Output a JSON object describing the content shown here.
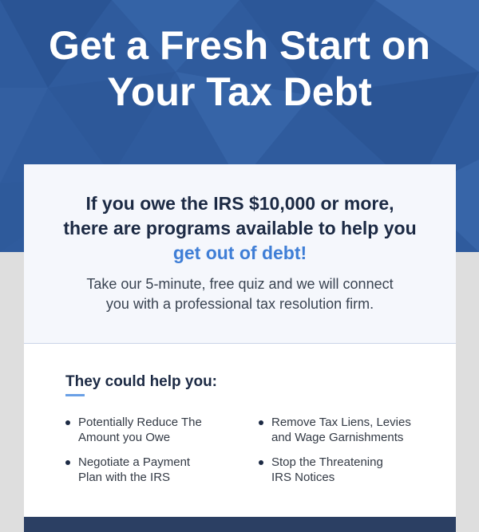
{
  "hero": {
    "title_line1": "Get a Fresh Start on",
    "title_line2": "Your Tax Debt",
    "background_color": "#2f5b9d"
  },
  "card": {
    "headline_line1": "If you owe the IRS $10,000 or more,",
    "headline_line2": "there are programs available to help you",
    "headline_accent": "get out of debt!",
    "subtext_line1": "Take our 5-minute, free quiz and we will connect",
    "subtext_line2": "you with a professional tax resolution firm.",
    "help_title": "They could help you:",
    "bullets_left": [
      {
        "line1": "Potentially Reduce The",
        "line2": "Amount you Owe"
      },
      {
        "line1": "Negotiate a Payment",
        "line2": "Plan with the IRS"
      }
    ],
    "bullets_right": [
      {
        "line1": "Remove Tax Liens, Levies",
        "line2": "and Wage Garnishments"
      },
      {
        "line1": "Stop the Threatening",
        "line2": "IRS Notices"
      }
    ],
    "accent_color": "#3f7ed6"
  }
}
